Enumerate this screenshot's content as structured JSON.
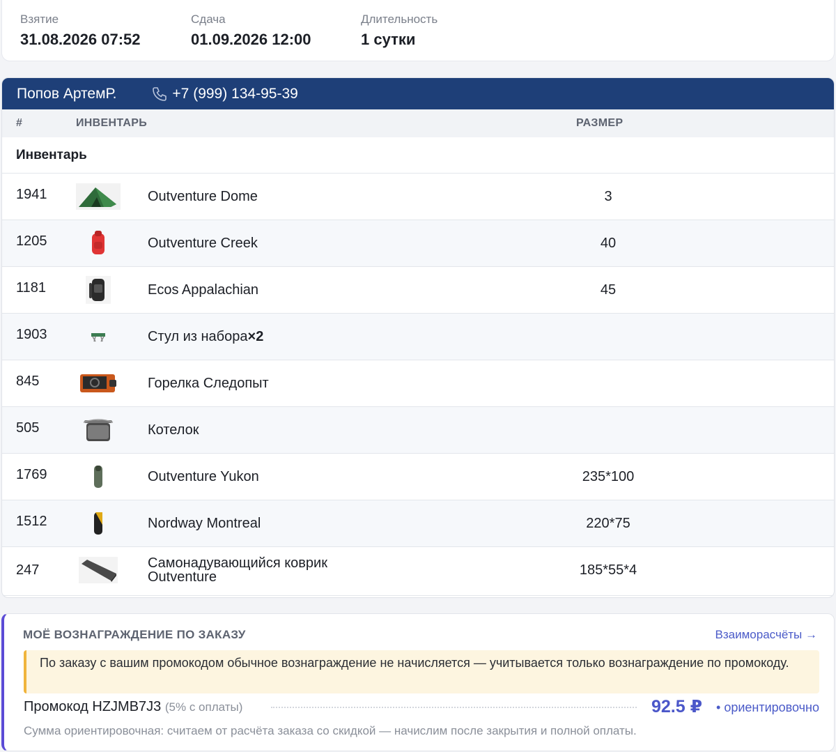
{
  "dates": {
    "pickup_label": "Взятие",
    "pickup_value": "31.08.2026 07:52",
    "return_label": "Сдача",
    "return_value": "01.09.2026 12:00",
    "duration_label": "Длительность",
    "duration_value": "1 сутки"
  },
  "order": {
    "customer_name": "Попов АртемР.",
    "phone": "+7 (999) 134-95-39",
    "columns": {
      "num": "#",
      "item": "ИНВЕНТАРЬ",
      "size": "РАЗМЕР"
    },
    "group_title": "Инвентарь",
    "rows": [
      {
        "id": "1941",
        "name": "Outventure Dome",
        "qty": "",
        "size": "3",
        "icon": "tent-icon"
      },
      {
        "id": "1205",
        "name": "Outventure Creek",
        "qty": "",
        "size": "40",
        "icon": "red-backpack-icon"
      },
      {
        "id": "1181",
        "name": "Ecos Appalachian",
        "qty": "",
        "size": "45",
        "icon": "black-backpack-icon"
      },
      {
        "id": "1903",
        "name": "Стул из набора",
        "qty": "×2",
        "size": "",
        "icon": "chair-icon"
      },
      {
        "id": "845",
        "name": "Горелка Следопыт",
        "qty": "",
        "size": "",
        "icon": "gas-burner-icon"
      },
      {
        "id": "505",
        "name": "Котелок",
        "qty": "",
        "size": "",
        "icon": "pot-icon"
      },
      {
        "id": "1769",
        "name": "Outventure Yukon",
        "qty": "",
        "size": "235*100",
        "icon": "sleeping-bag-green-icon"
      },
      {
        "id": "1512",
        "name": "Nordway Montreal",
        "qty": "",
        "size": "220*75",
        "icon": "sleeping-bag-yellow-icon"
      },
      {
        "id": "247",
        "name_line1": "Самонадувающийся коврик",
        "name_line2": "Outventure",
        "size": "185*55*4",
        "icon": "mat-icon"
      }
    ]
  },
  "reward": {
    "title": "МОЁ ВОЗНАГРАЖДЕНИЕ ПО ЗАКАЗУ",
    "link": "Взаиморасчёты →",
    "notice": "По заказу с вашим промокодом обычное вознаграждение не начисляется — учитывается только вознаграждение по промокоду.",
    "promo_label": "Промокод HZJMB7J3",
    "promo_pct": "(5% с оплаты)",
    "amount": "92.5 ₽",
    "estimate": "• ориентировочно",
    "footnote": "Сумма ориентировочная: считаем от расчёта заказа со скидкой — начислим после закрытия и полной оплаты.",
    "accent": "#5b4bd6",
    "notice_bg": "#fdf5e0"
  },
  "colors": {
    "header_bg": "#1e3f78",
    "link": "#4a5ac8"
  }
}
